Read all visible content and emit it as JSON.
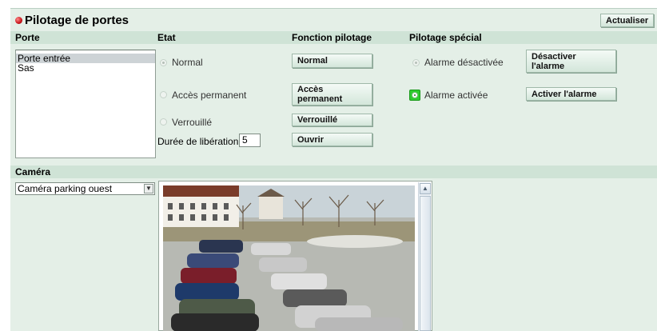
{
  "page": {
    "title": "Pilotage de portes",
    "refresh_button": "Actualiser"
  },
  "columns": {
    "porte": "Porte",
    "etat": "Etat",
    "fonction": "Fonction pilotage",
    "special": "Pilotage spécial"
  },
  "doors": [
    {
      "label": "Porte entrée",
      "selected": true
    },
    {
      "label": "Sas",
      "selected": false
    }
  ],
  "states": {
    "normal": "Normal",
    "permanent": "Accès permanent",
    "locked": "Verrouillé",
    "release_label": "Durée de libération",
    "release_value": "5"
  },
  "functions": {
    "normal": "Normal",
    "permanent_line1": "Accès",
    "permanent_line2": "permanent",
    "locked": "Verrouillé",
    "open": "Ouvrir"
  },
  "special": {
    "alarm_off_label": "Alarme désactivée",
    "alarm_on_label": "Alarme activée",
    "disable_line1": "Désactiver",
    "disable_line2": "l'alarme",
    "enable": "Activer l'alarme",
    "alarm_state": "activée"
  },
  "camera": {
    "section_label": "Caméra",
    "selected": "Caméra parking ouest"
  },
  "colors": {
    "panel_bg": "#e4efe7",
    "header_bar": "#cfe3d6",
    "alarm_active": "#2ecc2e"
  }
}
